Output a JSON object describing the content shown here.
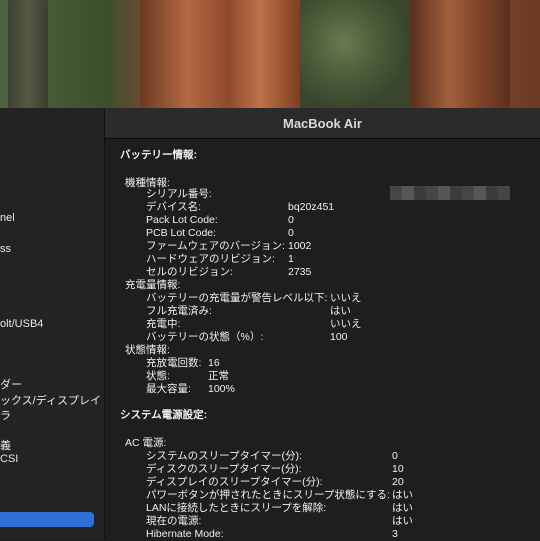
{
  "window": {
    "title": "MacBook Air"
  },
  "sidebar": {
    "items": [
      "nel",
      "ss",
      "olt/USB4",
      "ダー",
      "ックス/ディスプレイ",
      "ラ",
      "義",
      "CSI"
    ]
  },
  "battery": {
    "heading": "バッテリー情報:",
    "model": {
      "heading": "機種情報:",
      "rows": [
        {
          "label": "シリアル番号:",
          "value": ""
        },
        {
          "label": "デバイス名:",
          "value": "bq20z451"
        },
        {
          "label": "Pack Lot Code:",
          "value": "0"
        },
        {
          "label": "PCB Lot Code:",
          "value": "0"
        },
        {
          "label": "ファームウェアのバージョン:",
          "value": "1002"
        },
        {
          "label": "ハードウェアのリビジョン:",
          "value": "1"
        },
        {
          "label": "セルのリビジョン:",
          "value": "2735"
        }
      ]
    },
    "charge": {
      "heading": "充電量情報:",
      "rows": [
        {
          "label": "バッテリーの充電量が警告レベル以下:",
          "value": "いいえ"
        },
        {
          "label": "フル充電済み:",
          "value": "はい"
        },
        {
          "label": "充電中:",
          "value": "いいえ"
        },
        {
          "label": "バッテリーの状態（%）:",
          "value": "100"
        }
      ]
    },
    "health": {
      "heading": "状態情報:",
      "rows": [
        {
          "label": "充放電回数:",
          "value": "16"
        },
        {
          "label": "状態:",
          "value": "正常"
        },
        {
          "label": "最大容量:",
          "value": "100%"
        }
      ]
    }
  },
  "power": {
    "heading": "システム電源設定:",
    "ac": {
      "heading": "AC 電源:",
      "rows": [
        {
          "label": "システムのスリープタイマー(分):",
          "value": "0"
        },
        {
          "label": "ディスクのスリープタイマー(分):",
          "value": "10"
        },
        {
          "label": "ディスプレイのスリープタイマー(分):",
          "value": "20"
        },
        {
          "label": "パワーボタンが押されたときにスリープ状態にする:",
          "value": "はい"
        },
        {
          "label": "LANに接続したときにスリープを解除:",
          "value": "はい"
        },
        {
          "label": "現在の電源:",
          "value": "はい"
        },
        {
          "label": "Hibernate Mode:",
          "value": "3"
        }
      ]
    }
  }
}
